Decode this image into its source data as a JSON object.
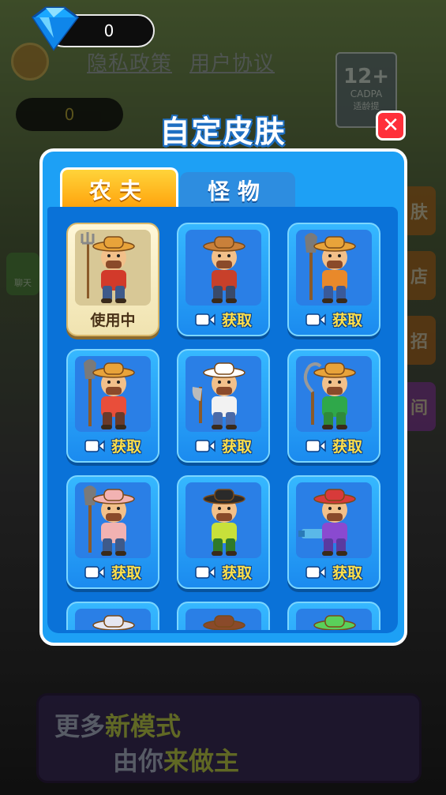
{
  "hud": {
    "gems_top": "0",
    "gems_second": "0",
    "privacy_link": "隐私政策",
    "agreement_link": "用户协议",
    "age_rating": "12+",
    "age_org": "CADPA",
    "age_note": "适龄提",
    "chat_label": "聊天",
    "side_buttons": [
      "肤",
      "店",
      "招",
      "间"
    ]
  },
  "dialog": {
    "title": "自定皮肤",
    "close_symbol": "✕",
    "tabs": [
      {
        "label": "农夫",
        "active": true
      },
      {
        "label": "怪物",
        "active": false
      }
    ],
    "skins": [
      {
        "id": "farmer-pitchfork",
        "label": "使用中",
        "selected": true,
        "shirt": "#d23a2a",
        "pants": "#3e5a8a",
        "hat": "#e8a33a",
        "tool": "pitchfork"
      },
      {
        "id": "farmer-redbeard",
        "label": "获取",
        "selected": false,
        "shirt": "#c8402a",
        "pants": "#3a4a6a",
        "hat": "#c9803a",
        "tool": "none"
      },
      {
        "id": "farmer-shovel",
        "label": "获取",
        "selected": false,
        "shirt": "#e9892a",
        "pants": "#3a5a9a",
        "hat": "#e8a33a",
        "tool": "shovel"
      },
      {
        "id": "farmer-leopard",
        "label": "获取",
        "selected": false,
        "shirt": "#e94e3a",
        "pants": "#6a3a2a",
        "hat": "#e8a33a",
        "tool": "shovel"
      },
      {
        "id": "farmer-bandana",
        "label": "获取",
        "selected": false,
        "shirt": "#f2f2f2",
        "pants": "#4a6aa8",
        "hat": "#ffffff",
        "tool": "axe"
      },
      {
        "id": "farmer-sickle",
        "label": "获取",
        "selected": false,
        "shirt": "#2fa84a",
        "pants": "#2f8a3a",
        "hat": "#e8a33a",
        "tool": "sickle"
      },
      {
        "id": "farmer-pig",
        "label": "获取",
        "selected": false,
        "shirt": "#f2b2b2",
        "pants": "#3e5a8a",
        "hat": "#f2b2b2",
        "tool": "shovel"
      },
      {
        "id": "farmer-boy",
        "label": "获取",
        "selected": false,
        "shirt": "#c8e03a",
        "pants": "#2f7a2a",
        "hat": "#2a2a2a",
        "tool": "none"
      },
      {
        "id": "farmer-helmet",
        "label": "获取",
        "selected": false,
        "shirt": "#8a4ad0",
        "pants": "#5a3aa0",
        "hat": "#d83a3a",
        "tool": "gun"
      },
      {
        "id": "farmer-partial-1",
        "label": "",
        "selected": false,
        "shirt": "#e0e0f0",
        "pants": "#5a5aa0",
        "hat": "#e6e6f0",
        "tool": "none"
      },
      {
        "id": "farmer-partial-2",
        "label": "",
        "selected": false,
        "shirt": "#a05a2a",
        "pants": "#3e5a8a",
        "hat": "#8a4a2a",
        "tool": "none"
      },
      {
        "id": "farmer-partial-3",
        "label": "",
        "selected": false,
        "shirt": "#5ad05a",
        "pants": "#3a9a3a",
        "hat": "#5ad05a",
        "tool": "none"
      }
    ]
  },
  "banner": {
    "line1_a": "更多",
    "line1_b": "新模式",
    "line2_a": "由你",
    "line2_b": "来做主"
  },
  "colors": {
    "dialog_bg": "#1da0f5",
    "tab_active": "#ffa20c",
    "label_yellow": "#ffe04a",
    "close_red": "#ff2f3a"
  }
}
